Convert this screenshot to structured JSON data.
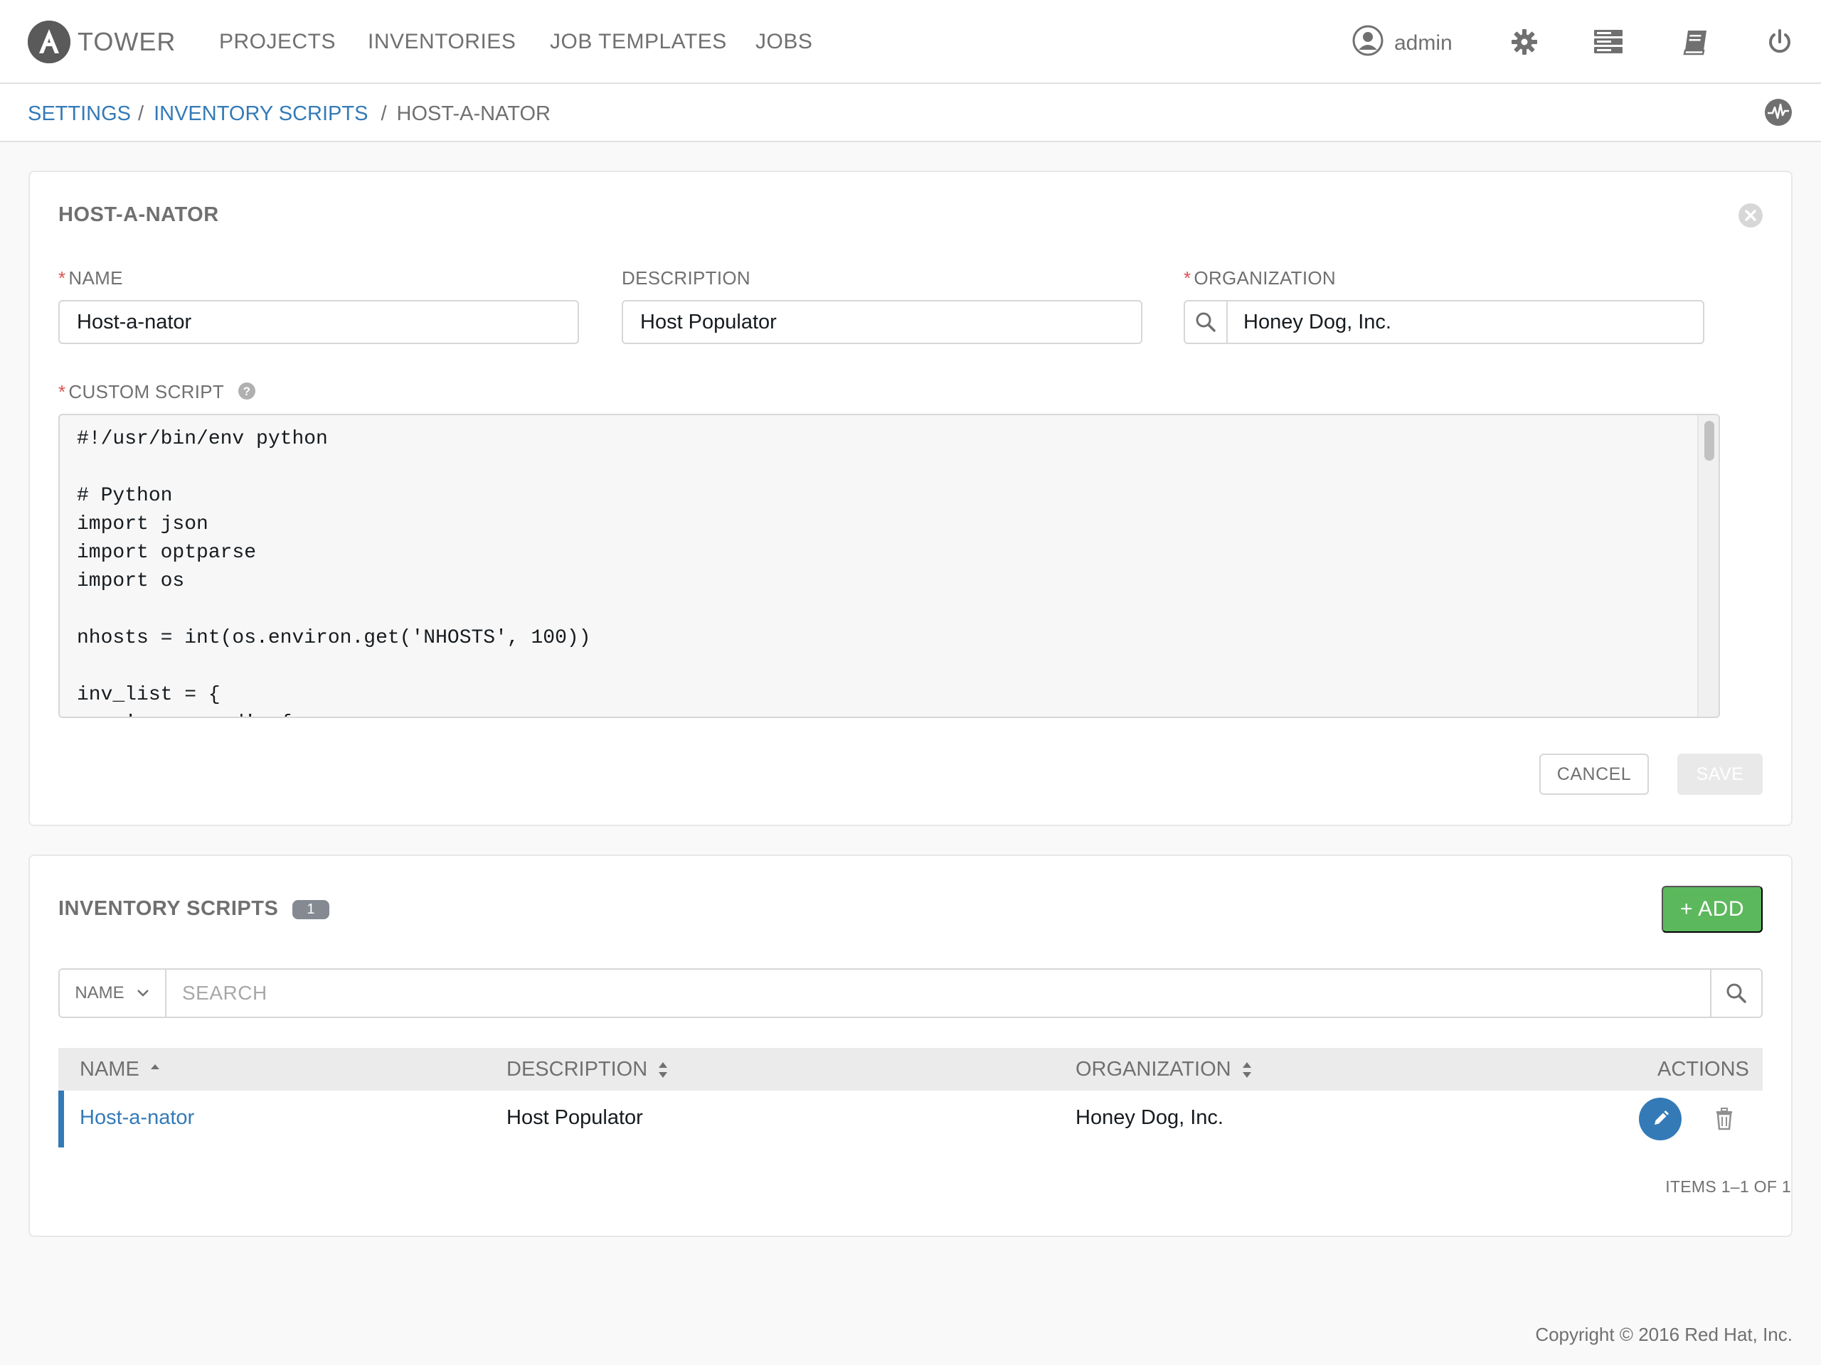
{
  "nav": {
    "brand": "TOWER",
    "links": [
      "PROJECTS",
      "INVENTORIES",
      "JOB TEMPLATES",
      "JOBS"
    ],
    "user": "admin"
  },
  "breadcrumb": {
    "settings": "SETTINGS",
    "inventory_scripts": "INVENTORY SCRIPTS",
    "current": "HOST-A-NATOR",
    "separator": "/"
  },
  "form": {
    "title": "HOST-A-NATOR",
    "required_mark": "*",
    "name_label": "NAME",
    "name_value": "Host-a-nator",
    "description_label": "DESCRIPTION",
    "description_value": "Host Populator",
    "organization_label": "ORGANIZATION",
    "organization_value": "Honey Dog, Inc.",
    "script_label": "CUSTOM SCRIPT",
    "script_lines": [
      "#!/usr/bin/env python",
      "",
      "# Python",
      "import json",
      "import optparse",
      "import os",
      "",
      "nhosts = int(os.environ.get('NHOSTS', 100))",
      "",
      "inv_list = {",
      "    'ungrouped': {"
    ],
    "cancel_label": "CANCEL",
    "save_label": "SAVE"
  },
  "list": {
    "title": "INVENTORY SCRIPTS",
    "count": "1",
    "add_label": "+ ADD",
    "search_key": "NAME",
    "search_placeholder": "SEARCH",
    "columns": {
      "name": "NAME",
      "description": "DESCRIPTION",
      "organization": "ORGANIZATION",
      "actions": "ACTIONS"
    },
    "rows": [
      {
        "name": "Host-a-nator",
        "description": "Host Populator",
        "organization": "Honey Dog, Inc."
      }
    ],
    "pagination": "ITEMS 1–1 OF 1"
  },
  "footer": "Copyright © 2016 Red Hat, Inc.",
  "colors": {
    "link": "#337ab7",
    "add_button": "#5cb85c",
    "required": "#d9534f",
    "badge": "#848992"
  }
}
